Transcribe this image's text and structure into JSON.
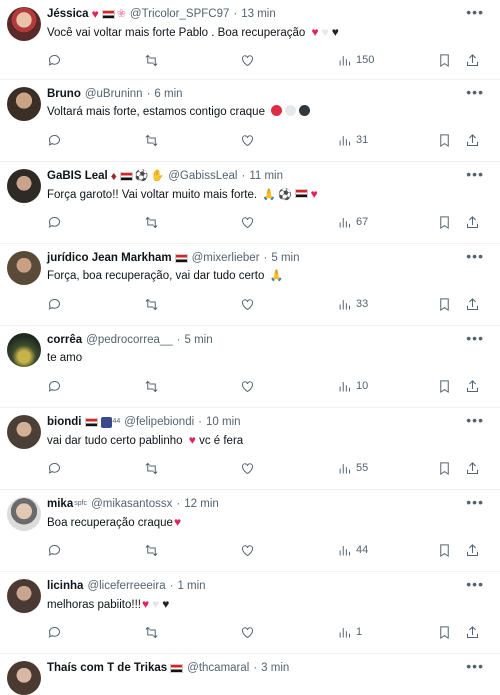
{
  "tweets": [
    {
      "name": "Jéssica",
      "handle": "@Tricolor_SPFC97",
      "time": "13 min",
      "text": "Você vai voltar mais forte Pablo . Boa recuperação",
      "views": "150"
    },
    {
      "name": "Bruno",
      "handle": "@uBruninn",
      "time": "6 min",
      "text": "Voltará mais forte, estamos contigo craque",
      "views": "31"
    },
    {
      "name": "GaBIS Leal",
      "handle": "@GabissLeal",
      "time": "11 min",
      "text": "Força garoto!! Vai voltar muito mais forte.",
      "views": "67"
    },
    {
      "name": "jurídico Jean Markham",
      "handle": "@mixerlieber",
      "time": "5 min",
      "text": "Força, boa recuperação, vai dar tudo certo",
      "views": "33"
    },
    {
      "name": "corrêa",
      "handle": "@pedrocorrea__",
      "time": "5 min",
      "text": "te amo",
      "views": "10"
    },
    {
      "name": "biondi",
      "name_badge": "44",
      "handle": "@felipebiondi",
      "time": "10 min",
      "text": "vai dar tudo certo pablinho",
      "text_suffix": "vc é fera",
      "views": "55"
    },
    {
      "name": "mika",
      "name_badge": "spfc",
      "handle": "@mikasantossx",
      "time": "12 min",
      "text": "Boa recuperação craque",
      "views": "44"
    },
    {
      "name": "licinha",
      "handle": "@liceferreeeira",
      "time": "1 min",
      "text": "melhoras pabiito!!!",
      "views": "1"
    },
    {
      "name": "Thaís com T de Trikas",
      "handle": "@thcamaral",
      "time": "3 min"
    }
  ],
  "colors": {
    "accent_red": "#e0245e",
    "muted": "#536471",
    "divider": "#eff3f4"
  },
  "icons": [
    "reply-icon",
    "retweet-icon",
    "like-icon",
    "views-icon",
    "bookmark-icon",
    "share-icon",
    "more-icon"
  ]
}
